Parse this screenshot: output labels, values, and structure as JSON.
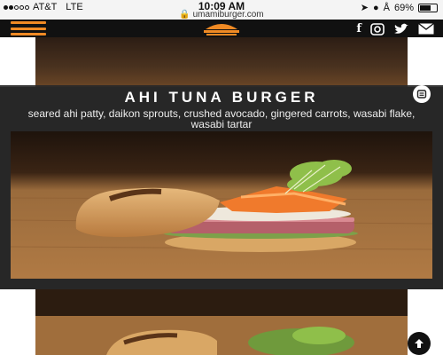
{
  "status_bar": {
    "carrier": "AT&T",
    "network": "LTE",
    "time": "10:09 AM",
    "url": "umamiburger.com",
    "battery_percent": "69%",
    "battery_level": 0.69
  },
  "nav": {
    "menu_icon": "hamburger-menu-icon",
    "logo_icon": "umami-burger-logo",
    "social_icons": [
      "facebook-icon",
      "instagram-icon",
      "twitter-icon",
      "email-icon"
    ],
    "accent_color": "#f08a24"
  },
  "item": {
    "title": "AHI TUNA BURGER",
    "description": "seared ahi patty, daikon sprouts, crushed avocado, gingered carrots, wasabi flake, wasabi tartar"
  }
}
